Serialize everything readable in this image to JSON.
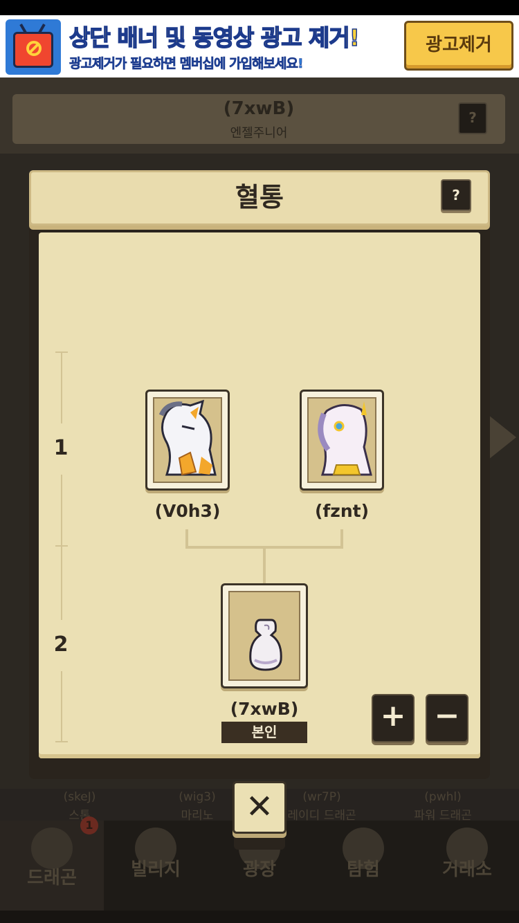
{
  "ad_banner": {
    "title": "상단 배너 및 동영상 광고 제거!",
    "subtitle": "광고제거가 필요하면 멤버십에 가입해보세요!",
    "button_label": "광고제거",
    "icon": "no-ads-tv-icon"
  },
  "background": {
    "dragon_code": "(7xwB)",
    "dragon_kind": "엔젤주니어",
    "help_label": "?",
    "cards": [
      {
        "code": "(skeJ)",
        "kind": "스톤"
      },
      {
        "code": "(wig3)",
        "kind": "마리노"
      },
      {
        "code": "(wr7P)",
        "kind": "레이디 드래곤"
      },
      {
        "code": "(pwhl)",
        "kind": "파워 드래곤"
      }
    ],
    "bottom_nav": [
      {
        "label": "드래곤",
        "icon": "dragon-icon",
        "selected": true,
        "badge": "1"
      },
      {
        "label": "빌리지",
        "icon": "village-icon"
      },
      {
        "label": "광장",
        "icon": "plaza-icon"
      },
      {
        "label": "탐험",
        "icon": "compass-icon"
      },
      {
        "label": "거래소",
        "icon": "exchange-icon"
      }
    ]
  },
  "modal": {
    "title": "혈통",
    "help_label": "?",
    "generations": [
      "1",
      "2"
    ],
    "parents": [
      {
        "name": "(V0h3)",
        "icon": "white-dragon-portrait"
      },
      {
        "name": "(fznt)",
        "icon": "white-unicorn-dragon-portrait"
      }
    ],
    "self": {
      "name": "(7xwB)",
      "badge": "본인",
      "icon": "egg-portrait"
    },
    "buttons": {
      "plus": "+",
      "minus": "−",
      "close": "✕"
    },
    "colors": {
      "panel": "#ebe0b4",
      "frame": "#2a241d",
      "text": "#2f2820"
    }
  }
}
